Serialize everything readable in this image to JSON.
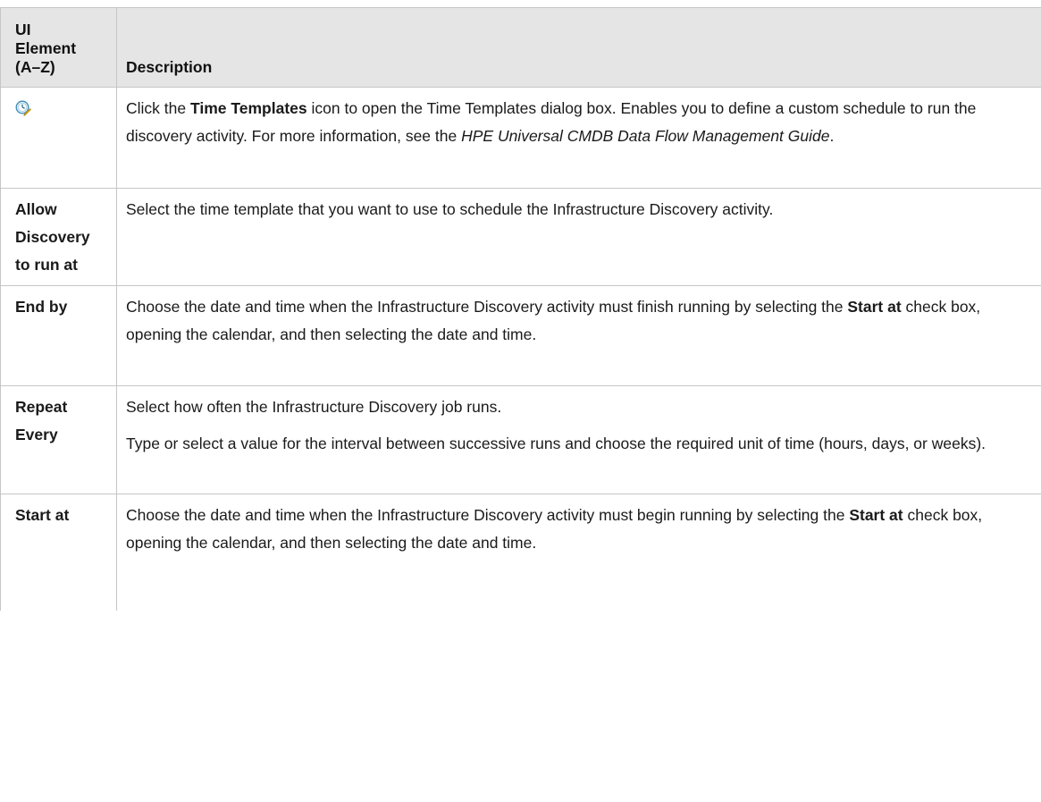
{
  "table": {
    "header": {
      "element_col": [
        "UI",
        "Element",
        "(A–Z)"
      ],
      "description_col": "Description"
    },
    "rows": [
      {
        "element_icon": "time-templates-icon",
        "description": [
          {
            "t1": "Click the ",
            "b1": "Time Templates",
            "t2": " icon to open the Time Templates dialog box. Enables you to define a custom schedule to run the discovery activity. For more information, see the ",
            "i1": "HPE Universal CMDB Data Flow Management Guide",
            "t3": "."
          }
        ]
      },
      {
        "element_label": "Allow Discovery to run at",
        "description": "Select the time template that you want to use to schedule the Infrastructure Discovery activity."
      },
      {
        "element_label": "End by",
        "description": {
          "t1": "Choose the date and time when the Infrastructure Discovery activity must finish running by selecting the ",
          "b1": "Start at",
          "t2": " check box, opening the calendar, and then selecting the date and time."
        }
      },
      {
        "element_label": "Repeat Every",
        "description_p1": "Select how often the Infrastructure Discovery job runs.",
        "description_p2": "Type or select a value for the interval between successive runs and choose the required unit of time (hours, days, or weeks)."
      },
      {
        "element_label": "Start at",
        "description": {
          "t1": "Choose the date and time when the Infrastructure Discovery activity must begin running by selecting the ",
          "b1": "Start at",
          "t2": " check box, opening the calendar, and then selecting the date and time."
        }
      }
    ]
  }
}
